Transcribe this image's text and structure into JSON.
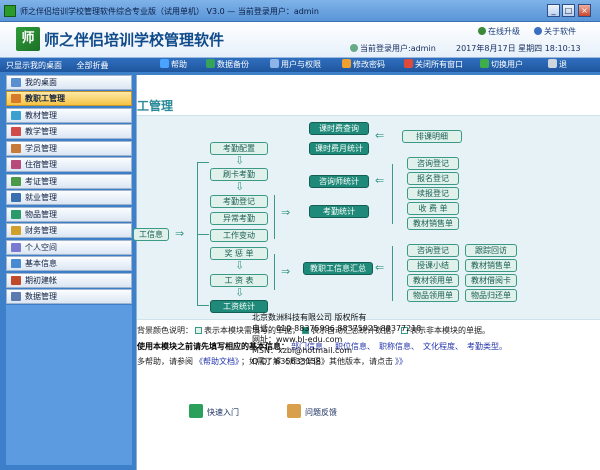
{
  "window": {
    "title": "师之伴侣培训学校管理软件综合专业版（试用单机） V3.0 — 当前登录用户：admin",
    "buttons": {
      "min": "_",
      "max": "□",
      "close": "×"
    }
  },
  "banner": {
    "logo_char": "师",
    "app_name": "师之伴侣培训学校管理软件",
    "online_upgrade": "在线升级",
    "about": "关于软件",
    "current_user": "当前登录用户:admin",
    "date": "2017年8月17日  星期四  18:10:13"
  },
  "toolbar": {
    "left": [
      "只显示我的桌面",
      "全部折叠"
    ],
    "items": [
      {
        "label": "帮助",
        "color": "#4aa3ff"
      },
      {
        "label": "数据备份",
        "color": "#35a35a"
      },
      {
        "label": "用户与权限",
        "color": "#8db4e6"
      },
      {
        "label": "修改密码",
        "color": "#f0a030"
      },
      {
        "label": "关闭所有窗口",
        "color": "#e04a3a"
      },
      {
        "label": "切换用户",
        "color": "#3fae4a"
      },
      {
        "label": "退",
        "color": "#d0d6de"
      }
    ]
  },
  "sidebar": {
    "items": [
      {
        "label": "我的桌面",
        "icon": "desktop-icon",
        "color": "#5a8fd0"
      },
      {
        "label": "教职工管理",
        "icon": "staff-icon",
        "color": "#d97a2a"
      },
      {
        "label": "教材管理",
        "icon": "book-icon",
        "color": "#3aa0d0"
      },
      {
        "label": "教学管理",
        "icon": "teach-icon",
        "color": "#d04a4a"
      },
      {
        "label": "学员管理",
        "icon": "student-icon",
        "color": "#c87a3a"
      },
      {
        "label": "住宿管理",
        "icon": "dorm-icon",
        "color": "#b84a7a"
      },
      {
        "label": "考证管理",
        "icon": "certificate-icon",
        "color": "#4a9a4a"
      },
      {
        "label": "就业管理",
        "icon": "employment-icon",
        "color": "#3a70b0"
      },
      {
        "label": "物品管理",
        "icon": "goods-icon",
        "color": "#2a9a6a"
      },
      {
        "label": "财务管理",
        "icon": "finance-icon",
        "color": "#d0a02a"
      },
      {
        "label": "个人空间",
        "icon": "personal-icon",
        "color": "#7a7ad0"
      },
      {
        "label": "基本信息",
        "icon": "info-icon",
        "color": "#4a8ad0"
      },
      {
        "label": "期初建帐",
        "icon": "account-icon",
        "color": "#c04a2a"
      },
      {
        "label": "数据管理",
        "icon": "data-icon",
        "color": "#5a7ab0"
      }
    ],
    "active_index": 1
  },
  "content": {
    "header": "工管理",
    "diagram": {
      "left_edge": "工信息",
      "col1": [
        "考勤配置",
        "刷卡考勤",
        "考勤登记",
        "异常考勤",
        "工作变动",
        "奖 惩 单",
        "工 资 表",
        "工资统计"
      ],
      "col2": [
        "课时费查询",
        "课时费月统计",
        "咨询师统计",
        "考勤统计",
        "教职工信息汇总"
      ],
      "top_right": "排课明细",
      "group1": [
        "咨询登记",
        "报名登记",
        "续报登记",
        "收 费 单",
        "教材销售单"
      ],
      "group2": [
        "咨询登记",
        "跟踪回访",
        "授课小结",
        "教材销售单",
        "教材领用单",
        "教材借阅卡",
        "物品领用单",
        "物品归还单"
      ]
    },
    "legend": {
      "prefix": "背景颜色说明：",
      "items": [
        "表示本模块需填写的单据，",
        "表示自动汇总统计数据，",
        "表示非本模块的单据。"
      ]
    },
    "note1": {
      "prefix": "使用本模块之前请先填写相应的基本信息：",
      "links": [
        "部门信息、",
        "职位信息、",
        "职称信息、",
        "文化程度、",
        "考勤类型。"
      ]
    },
    "note2": {
      "prefix": "多帮助，请参阅",
      "link1": "《帮助文档》",
      "mid": "；如需了解《师之伴侣》其他版本，请点击",
      "link2": "》》"
    },
    "bottom": {
      "quick_start": "快速入门",
      "feedback": "问题反馈",
      "company": "北京数洲科技有限公司 版权所有",
      "phone": "电话：010-88375996 88375925 88377218",
      "website": "网址：www.bl-edu.com",
      "msn": "MSN：xzbl@hotmail.com",
      "qq": "Q Q：635633158"
    }
  }
}
